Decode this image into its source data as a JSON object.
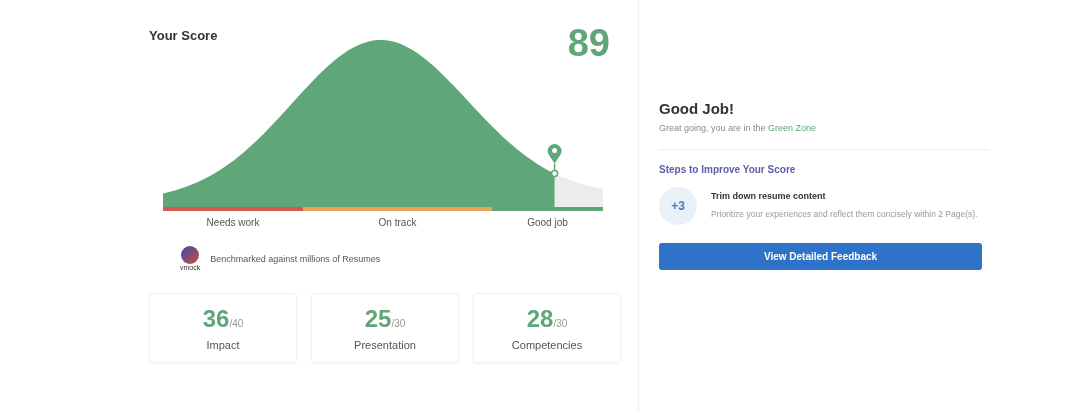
{
  "score_panel": {
    "title": "Your Score",
    "score": "89",
    "zones": [
      {
        "label": "Needs work",
        "color": "#d5574f"
      },
      {
        "label": "On track",
        "color": "#e8a25a"
      },
      {
        "label": "Good job",
        "color": "#5fa678"
      }
    ],
    "benchmark": {
      "logo_text": "vmock",
      "text": "Benchmarked against millions of Resumes"
    },
    "subscores": [
      {
        "value": "36",
        "max": "/40",
        "label": "Impact"
      },
      {
        "value": "25",
        "max": "/30",
        "label": "Presentation"
      },
      {
        "value": "28",
        "max": "/30",
        "label": "Competencies"
      }
    ]
  },
  "feedback_panel": {
    "heading": "Good Job!",
    "message": "Great going, you are in the ",
    "highlight": "Green Zone",
    "steps_title": "Steps to Improve Your Score",
    "steps": [
      {
        "points": "+3",
        "title": "Trim down resume content",
        "description": "Prioritize your experiences and reflect them concisely within 2 Page(s)."
      }
    ],
    "button": "View Detailed Feedback"
  }
}
